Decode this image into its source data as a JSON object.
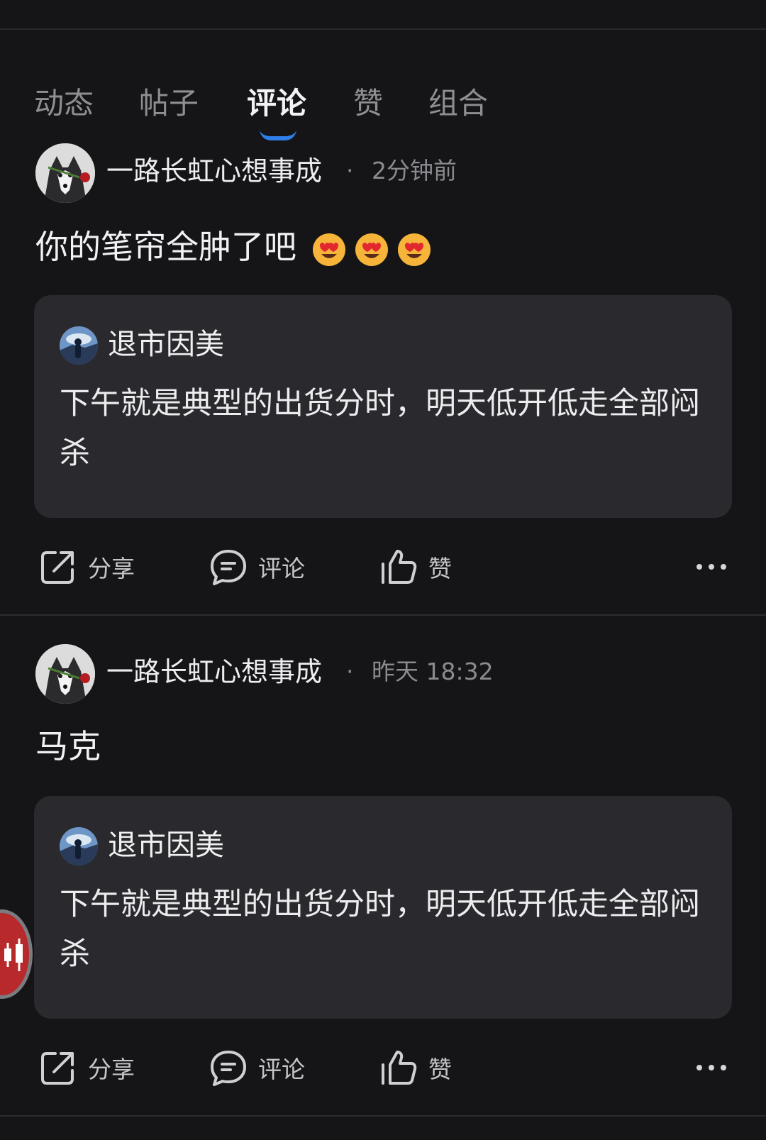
{
  "tabs": [
    {
      "label": "动态",
      "active": false
    },
    {
      "label": "帖子",
      "active": false
    },
    {
      "label": "评论",
      "active": true
    },
    {
      "label": "赞",
      "active": false
    },
    {
      "label": "组合",
      "active": false
    }
  ],
  "comments": [
    {
      "username": "一路长虹心想事成",
      "time": "2分钟前",
      "text": "你的笔帘全肿了吧",
      "emoji": [
        "heart-eyes",
        "heart-eyes",
        "heart-eyes"
      ],
      "quote": {
        "username": "退市因美",
        "text": "下午就是典型的出货分时，明天低开低走全部闷杀"
      }
    },
    {
      "username": "一路长虹心想事成",
      "time": "昨天 18:32",
      "text": "马克",
      "emoji": [],
      "quote": {
        "username": "退市因美",
        "text": "下午就是典型的出货分时，明天低开低走全部闷杀"
      }
    }
  ],
  "actions": {
    "share": "分享",
    "comment": "评论",
    "like": "赞"
  },
  "meta_separator": "·",
  "colors": {
    "background": "#151517",
    "quote_background": "#2a2a2e",
    "accent": "#2f7fe8",
    "muted_text": "#8a8a90"
  }
}
